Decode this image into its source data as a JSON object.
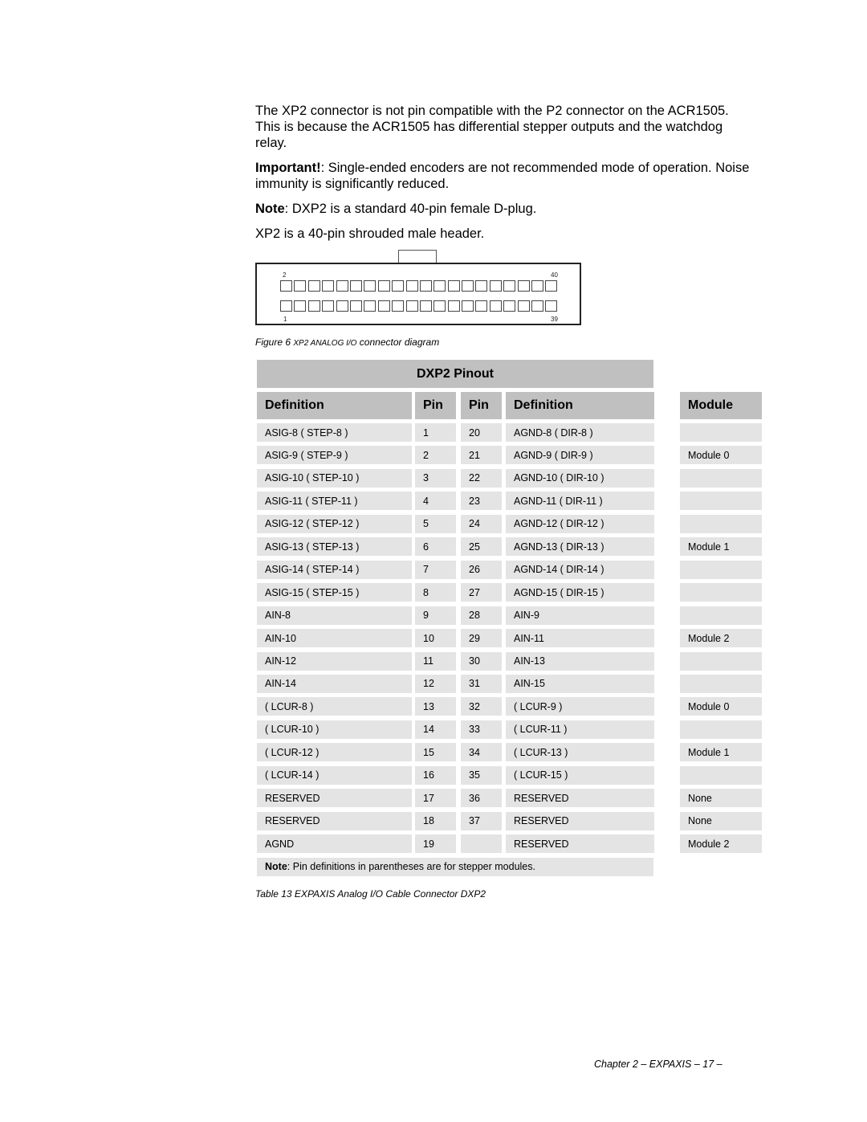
{
  "paragraphs": {
    "p1": "The XP2 connector is not pin compatible with the P2 connector on the ACR1505. This is because the ACR1505 has differential stepper outputs and the watchdog relay.",
    "p2_bold": "Important!",
    "p2_rest": ": Single-ended encoders are not recommended mode of operation. Noise immunity is significantly reduced.",
    "p3_bold": "Note",
    "p3_rest": ": DXP2 is a standard 40-pin female D-plug.",
    "p4": "XP2 is a 40-pin shrouded male header."
  },
  "connector": {
    "pin_count": 40,
    "label_top_left": "2",
    "label_top_right": "40",
    "label_bottom_left": "1",
    "label_bottom_right": "39"
  },
  "figure_caption": {
    "prefix": "Figure 6 ",
    "smallcaps": "XP2 ANALOG I/O",
    "suffix": " connector diagram"
  },
  "table": {
    "title": "DXP2 Pinout",
    "headers": [
      "Definition",
      "Pin",
      "Pin",
      "Definition",
      "Module"
    ],
    "rows": [
      {
        "def1": "ASIG-8 ( STEP-8 )",
        "pin1": "1",
        "pin2": "20",
        "def2": "AGND-8 ( DIR-8 )",
        "module": ""
      },
      {
        "def1": "ASIG-9 ( STEP-9 )",
        "pin1": "2",
        "pin2": "21",
        "def2": "AGND-9 ( DIR-9 )",
        "module": "Module 0"
      },
      {
        "def1": "ASIG-10 ( STEP-10 )",
        "pin1": "3",
        "pin2": "22",
        "def2": "AGND-10 ( DIR-10 )",
        "module": ""
      },
      {
        "def1": "ASIG-11 ( STEP-11 )",
        "pin1": "4",
        "pin2": "23",
        "def2": "AGND-11 ( DIR-11 )",
        "module": ""
      },
      {
        "def1": "ASIG-12 ( STEP-12 )",
        "pin1": "5",
        "pin2": "24",
        "def2": "AGND-12 ( DIR-12 )",
        "module": ""
      },
      {
        "def1": "ASIG-13 ( STEP-13 )",
        "pin1": "6",
        "pin2": "25",
        "def2": "AGND-13 ( DIR-13 )",
        "module": "Module 1"
      },
      {
        "def1": "ASIG-14 ( STEP-14 )",
        "pin1": "7",
        "pin2": "26",
        "def2": "AGND-14 ( DIR-14 )",
        "module": ""
      },
      {
        "def1": "ASIG-15 ( STEP-15 )",
        "pin1": "8",
        "pin2": "27",
        "def2": "AGND-15 ( DIR-15 )",
        "module": ""
      },
      {
        "def1": "AIN-8",
        "pin1": "9",
        "pin2": "28",
        "def2": "AIN-9",
        "module": ""
      },
      {
        "def1": "AIN-10",
        "pin1": "10",
        "pin2": "29",
        "def2": "AIN-11",
        "module": "Module 2"
      },
      {
        "def1": "AIN-12",
        "pin1": "11",
        "pin2": "30",
        "def2": "AIN-13",
        "module": ""
      },
      {
        "def1": "AIN-14",
        "pin1": "12",
        "pin2": "31",
        "def2": "AIN-15",
        "module": ""
      },
      {
        "def1": "( LCUR-8 )",
        "pin1": "13",
        "pin2": "32",
        "def2": "( LCUR-9 )",
        "module": "Module 0"
      },
      {
        "def1": "( LCUR-10 )",
        "pin1": "14",
        "pin2": "33",
        "def2": "( LCUR-11 )",
        "module": ""
      },
      {
        "def1": "( LCUR-12 )",
        "pin1": "15",
        "pin2": "34",
        "def2": "( LCUR-13 )",
        "module": "Module 1"
      },
      {
        "def1": "( LCUR-14 )",
        "pin1": "16",
        "pin2": "35",
        "def2": "( LCUR-15 )",
        "module": ""
      },
      {
        "def1": "RESERVED",
        "pin1": "17",
        "pin2": "36",
        "def2": "RESERVED",
        "module": "None"
      },
      {
        "def1": "RESERVED",
        "pin1": "18",
        "pin2": "37",
        "def2": "RESERVED",
        "module": "None"
      },
      {
        "def1": "AGND",
        "pin1": "19",
        "pin2": "",
        "def2": "RESERVED",
        "module": "Module 2"
      }
    ],
    "note_bold": "Note",
    "note_rest": ": Pin definitions in parentheses are for stepper modules."
  },
  "table_caption": "Table 13 EXPAXIS Analog I/O Cable Connector DXP2",
  "footer": "Chapter 2 – EXPAXIS – 17 –"
}
